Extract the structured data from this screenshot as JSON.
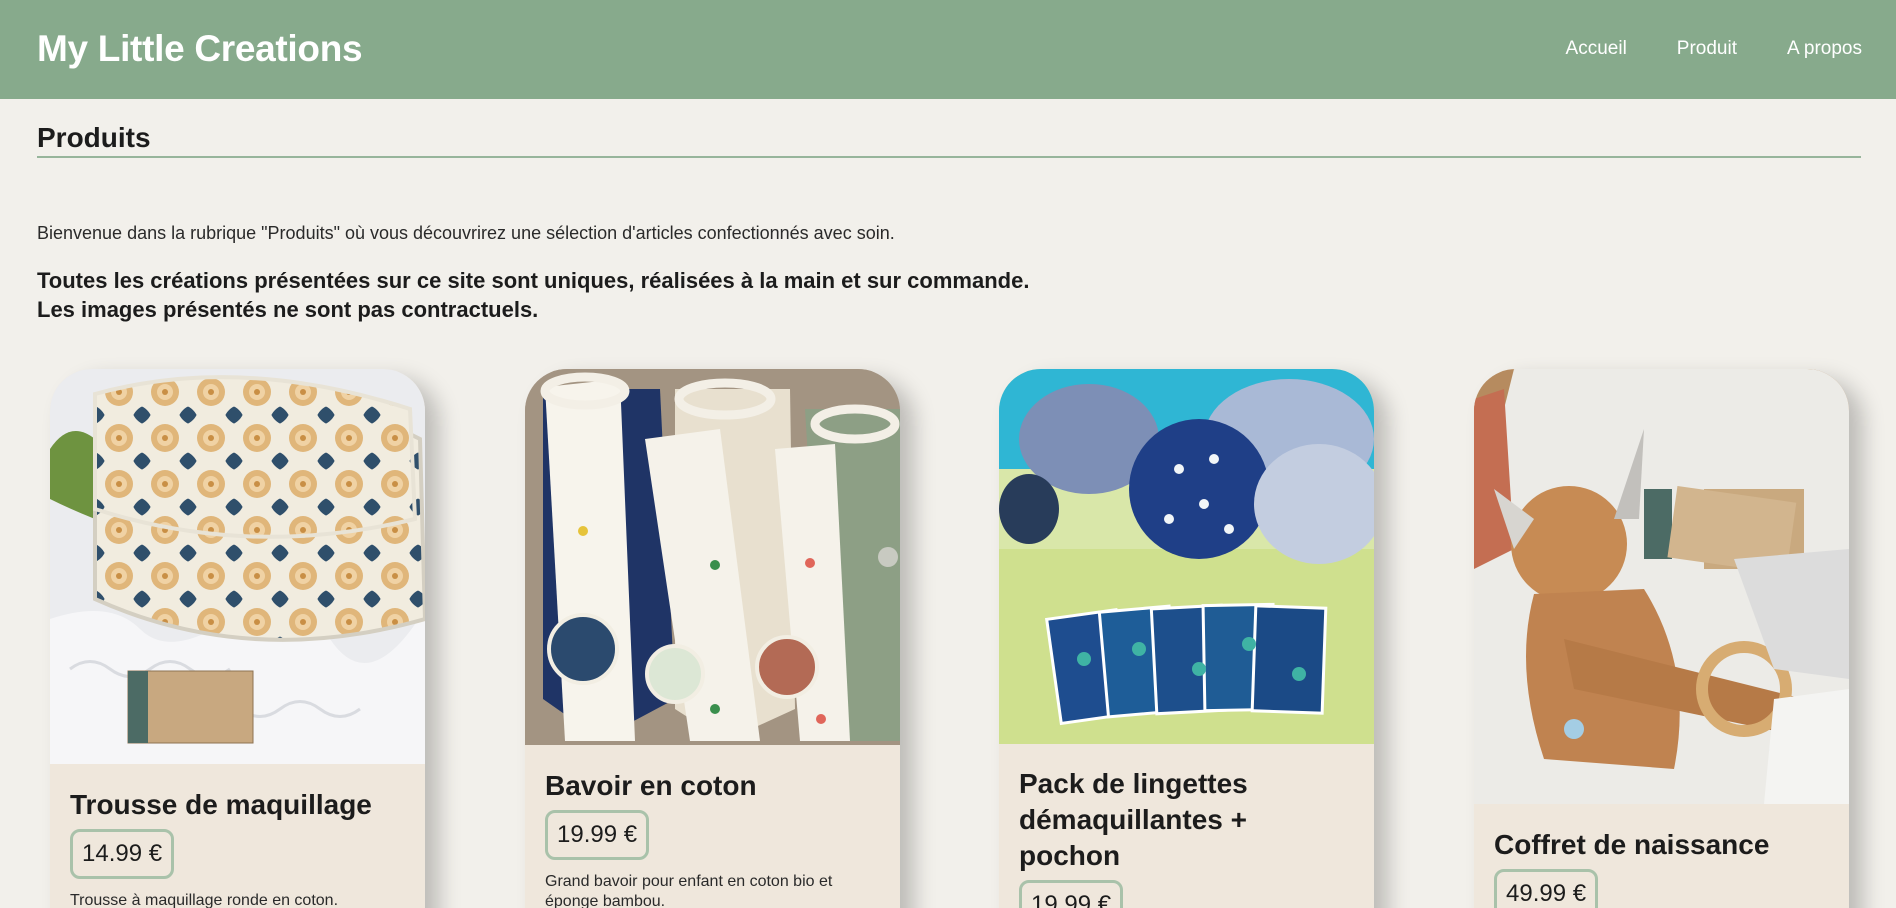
{
  "header": {
    "brand": "My Little Creations",
    "nav": [
      "Accueil",
      "Produit",
      "A propos"
    ],
    "background": "#87aa8c"
  },
  "page": {
    "title": "Produits",
    "intro": "Bienvenue dans la rubrique \"Produits\" où vous découvrirez une sélection d'articles confectionnés avec soin.",
    "notice_line1": "Toutes les créations présentées sur ce site sont uniques, réalisées à la main et sur commande.",
    "notice_line2": "Les images présentés ne sont pas contractuels."
  },
  "products": [
    {
      "name": "Trousse de maquillage",
      "price": "14.99 €",
      "description": "Trousse à maquillage ronde en coton.",
      "image": "makeup-pouch-photo"
    },
    {
      "name": "Bavoir en coton",
      "price": "19.99 €",
      "description": "Grand bavoir pour enfant en coton bio et éponge bambou.",
      "image": "cotton-bibs-photo"
    },
    {
      "name": "Pack de lingettes démaquillantes + pochon",
      "price": "19.99 €",
      "description": "",
      "image": "makeup-wipes-photo"
    },
    {
      "name": "Coffret de naissance",
      "price": "49.99 €",
      "description": "",
      "image": "birth-gift-box-photo"
    }
  ],
  "colors": {
    "accent": "#87aa8c",
    "page_background": "#f2f0eb",
    "card_background": "#efe7dc",
    "price_border": "#a9c2aa"
  }
}
